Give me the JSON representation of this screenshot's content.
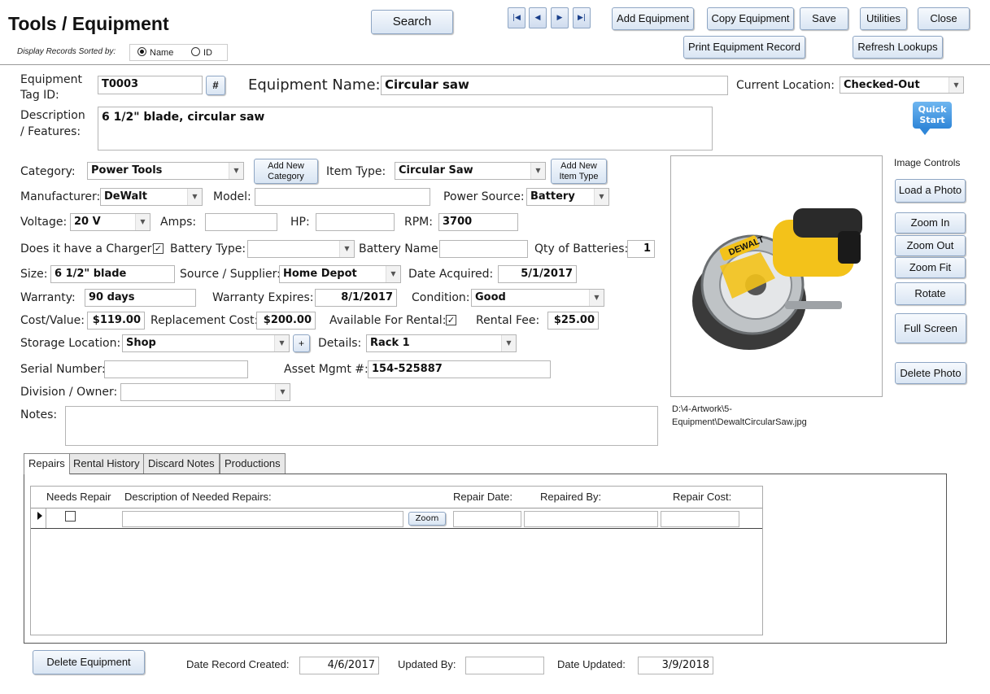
{
  "header": {
    "title": "Tools / Equipment",
    "sort_label": "Display Records Sorted by:",
    "sort_name": "Name",
    "sort_id": "ID",
    "search": "Search"
  },
  "toolbar": {
    "add": "Add Equipment",
    "copy": "Copy Equipment",
    "save": "Save",
    "utilities": "Utilities",
    "close": "Close",
    "print": "Print Equipment Record",
    "refresh": "Refresh Lookups"
  },
  "form": {
    "tag_label1": "Equipment",
    "tag_label2": "Tag ID:",
    "tag_value": "T0003",
    "hash": "#",
    "name_label": "Equipment Name:",
    "name_value": "Circular saw",
    "loc_label": "Current Location:",
    "loc_value": "Checked-Out",
    "desc_label1": "Description",
    "desc_label2": "/ Features:",
    "desc_value": "6 1/2\" blade, circular saw",
    "quick1": "Quick",
    "quick2": "Start",
    "cat_label": "Category:",
    "cat_value": "Power Tools",
    "add_cat1": "Add New",
    "add_cat2": "Category",
    "type_label": "Item Type:",
    "type_value": "Circular Saw",
    "add_type1": "Add New",
    "add_type2": "Item Type",
    "mfr_label": "Manufacturer:",
    "mfr_value": "DeWalt",
    "model_label": "Model:",
    "model_value": "",
    "power_label": "Power Source:",
    "power_value": "Battery",
    "volt_label": "Voltage:",
    "volt_value": "20 V",
    "amps_label": "Amps:",
    "amps_value": "",
    "hp_label": "HP:",
    "hp_value": "",
    "rpm_label": "RPM:",
    "rpm_value": "3700",
    "charger_label": "Does it have a Charger?",
    "charger_checked": true,
    "charger_mark": "✓",
    "battype_label": "Battery Type:",
    "battype_value": "",
    "batname_label": "Battery Name:",
    "batname_value": "",
    "qty_label": "Qty of Batteries:",
    "qty_value": "1",
    "size_label": "Size:",
    "size_value": "6 1/2\" blade",
    "source_label": "Source / Supplier:",
    "source_value": "Home Depot",
    "acq_label": "Date Acquired:",
    "acq_value": "5/1/2017",
    "warr_label": "Warranty:",
    "warr_value": "90 days",
    "wexp_label": "Warranty Expires:",
    "wexp_value": "8/1/2017",
    "cond_label": "Condition:",
    "cond_value": "Good",
    "cost_label": "Cost/Value:",
    "cost_value": "$119.00",
    "repl_label": "Replacement Cost:",
    "repl_value": "$200.00",
    "avail_label": "Available For Rental:",
    "avail_mark": "✓",
    "fee_label": "Rental Fee:",
    "fee_value": "$25.00",
    "stor_label": "Storage Location:",
    "stor_value": "Shop",
    "plus": "+",
    "details_label": "Details:",
    "details_value": "Rack 1",
    "serial_label": "Serial Number:",
    "serial_value": "",
    "asset_label": "Asset Mgmt #:",
    "asset_value": "154-525887",
    "div_label": "Division / Owner:",
    "div_value": "",
    "notes_label": "Notes:",
    "notes_value": ""
  },
  "image": {
    "controls_label": "Image Controls",
    "load": "Load a Photo",
    "zoom_in": "Zoom In",
    "zoom_out": "Zoom Out",
    "zoom_fit": "Zoom Fit",
    "rotate": "Rotate",
    "full": "Full Screen",
    "delete": "Delete Photo",
    "path": "D:\\4-Artwork\\5-Equipment\\DewaltCircularSaw.jpg",
    "path1": "D:\\4-Artwork\\5-",
    "path2": "Equipment\\DewaltCircularSaw.jpg",
    "brand": "DEWALT"
  },
  "tabs": [
    "Repairs",
    "Rental History",
    "Discard Notes",
    "Productions"
  ],
  "repairs": {
    "needs": "Needs Repair",
    "desc": "Description of Needed Repairs:",
    "date": "Repair Date:",
    "by": "Repaired By:",
    "cost": "Repair Cost:",
    "zoom": "Zoom"
  },
  "footer": {
    "delete": "Delete Equipment",
    "created_label": "Date Record Created:",
    "created": "4/6/2017",
    "updby_label": "Updated By:",
    "updby": "",
    "upd_label": "Date Updated:",
    "upd": "3/9/2018"
  },
  "icons": {
    "first": "first-record-icon",
    "prev": "previous-record-icon",
    "next": "next-record-icon",
    "last": "last-record-icon"
  }
}
